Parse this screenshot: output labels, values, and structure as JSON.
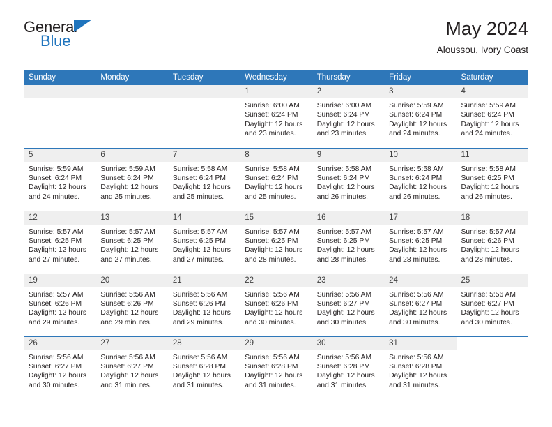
{
  "brand": {
    "name_part1": "General",
    "name_part2": "Blue",
    "triangle_icon": "triangle-icon",
    "accent_color": "#1f74bd"
  },
  "header": {
    "title": "May 2024",
    "subtitle": "Aloussou, Ivory Coast"
  },
  "theme": {
    "header_bg": "#2e77b9",
    "daynum_bg": "#efefef",
    "text": "#231f20"
  },
  "calendar": {
    "weekday_headers": [
      "Sunday",
      "Monday",
      "Tuesday",
      "Wednesday",
      "Thursday",
      "Friday",
      "Saturday"
    ],
    "weeks": [
      [
        {
          "day": "",
          "sunrise": "",
          "sunset": "",
          "daylight_line1": "",
          "daylight_line2": "",
          "blank": true
        },
        {
          "day": "",
          "sunrise": "",
          "sunset": "",
          "daylight_line1": "",
          "daylight_line2": "",
          "blank": true
        },
        {
          "day": "",
          "sunrise": "",
          "sunset": "",
          "daylight_line1": "",
          "daylight_line2": "",
          "blank": true
        },
        {
          "day": "1",
          "sunrise": "Sunrise: 6:00 AM",
          "sunset": "Sunset: 6:24 PM",
          "daylight_line1": "Daylight: 12 hours",
          "daylight_line2": "and 23 minutes."
        },
        {
          "day": "2",
          "sunrise": "Sunrise: 6:00 AM",
          "sunset": "Sunset: 6:24 PM",
          "daylight_line1": "Daylight: 12 hours",
          "daylight_line2": "and 23 minutes."
        },
        {
          "day": "3",
          "sunrise": "Sunrise: 5:59 AM",
          "sunset": "Sunset: 6:24 PM",
          "daylight_line1": "Daylight: 12 hours",
          "daylight_line2": "and 24 minutes."
        },
        {
          "day": "4",
          "sunrise": "Sunrise: 5:59 AM",
          "sunset": "Sunset: 6:24 PM",
          "daylight_line1": "Daylight: 12 hours",
          "daylight_line2": "and 24 minutes."
        }
      ],
      [
        {
          "day": "5",
          "sunrise": "Sunrise: 5:59 AM",
          "sunset": "Sunset: 6:24 PM",
          "daylight_line1": "Daylight: 12 hours",
          "daylight_line2": "and 24 minutes."
        },
        {
          "day": "6",
          "sunrise": "Sunrise: 5:59 AM",
          "sunset": "Sunset: 6:24 PM",
          "daylight_line1": "Daylight: 12 hours",
          "daylight_line2": "and 25 minutes."
        },
        {
          "day": "7",
          "sunrise": "Sunrise: 5:58 AM",
          "sunset": "Sunset: 6:24 PM",
          "daylight_line1": "Daylight: 12 hours",
          "daylight_line2": "and 25 minutes."
        },
        {
          "day": "8",
          "sunrise": "Sunrise: 5:58 AM",
          "sunset": "Sunset: 6:24 PM",
          "daylight_line1": "Daylight: 12 hours",
          "daylight_line2": "and 25 minutes."
        },
        {
          "day": "9",
          "sunrise": "Sunrise: 5:58 AM",
          "sunset": "Sunset: 6:24 PM",
          "daylight_line1": "Daylight: 12 hours",
          "daylight_line2": "and 26 minutes."
        },
        {
          "day": "10",
          "sunrise": "Sunrise: 5:58 AM",
          "sunset": "Sunset: 6:24 PM",
          "daylight_line1": "Daylight: 12 hours",
          "daylight_line2": "and 26 minutes."
        },
        {
          "day": "11",
          "sunrise": "Sunrise: 5:58 AM",
          "sunset": "Sunset: 6:25 PM",
          "daylight_line1": "Daylight: 12 hours",
          "daylight_line2": "and 26 minutes."
        }
      ],
      [
        {
          "day": "12",
          "sunrise": "Sunrise: 5:57 AM",
          "sunset": "Sunset: 6:25 PM",
          "daylight_line1": "Daylight: 12 hours",
          "daylight_line2": "and 27 minutes."
        },
        {
          "day": "13",
          "sunrise": "Sunrise: 5:57 AM",
          "sunset": "Sunset: 6:25 PM",
          "daylight_line1": "Daylight: 12 hours",
          "daylight_line2": "and 27 minutes."
        },
        {
          "day": "14",
          "sunrise": "Sunrise: 5:57 AM",
          "sunset": "Sunset: 6:25 PM",
          "daylight_line1": "Daylight: 12 hours",
          "daylight_line2": "and 27 minutes."
        },
        {
          "day": "15",
          "sunrise": "Sunrise: 5:57 AM",
          "sunset": "Sunset: 6:25 PM",
          "daylight_line1": "Daylight: 12 hours",
          "daylight_line2": "and 28 minutes."
        },
        {
          "day": "16",
          "sunrise": "Sunrise: 5:57 AM",
          "sunset": "Sunset: 6:25 PM",
          "daylight_line1": "Daylight: 12 hours",
          "daylight_line2": "and 28 minutes."
        },
        {
          "day": "17",
          "sunrise": "Sunrise: 5:57 AM",
          "sunset": "Sunset: 6:25 PM",
          "daylight_line1": "Daylight: 12 hours",
          "daylight_line2": "and 28 minutes."
        },
        {
          "day": "18",
          "sunrise": "Sunrise: 5:57 AM",
          "sunset": "Sunset: 6:26 PM",
          "daylight_line1": "Daylight: 12 hours",
          "daylight_line2": "and 28 minutes."
        }
      ],
      [
        {
          "day": "19",
          "sunrise": "Sunrise: 5:57 AM",
          "sunset": "Sunset: 6:26 PM",
          "daylight_line1": "Daylight: 12 hours",
          "daylight_line2": "and 29 minutes."
        },
        {
          "day": "20",
          "sunrise": "Sunrise: 5:56 AM",
          "sunset": "Sunset: 6:26 PM",
          "daylight_line1": "Daylight: 12 hours",
          "daylight_line2": "and 29 minutes."
        },
        {
          "day": "21",
          "sunrise": "Sunrise: 5:56 AM",
          "sunset": "Sunset: 6:26 PM",
          "daylight_line1": "Daylight: 12 hours",
          "daylight_line2": "and 29 minutes."
        },
        {
          "day": "22",
          "sunrise": "Sunrise: 5:56 AM",
          "sunset": "Sunset: 6:26 PM",
          "daylight_line1": "Daylight: 12 hours",
          "daylight_line2": "and 30 minutes."
        },
        {
          "day": "23",
          "sunrise": "Sunrise: 5:56 AM",
          "sunset": "Sunset: 6:27 PM",
          "daylight_line1": "Daylight: 12 hours",
          "daylight_line2": "and 30 minutes."
        },
        {
          "day": "24",
          "sunrise": "Sunrise: 5:56 AM",
          "sunset": "Sunset: 6:27 PM",
          "daylight_line1": "Daylight: 12 hours",
          "daylight_line2": "and 30 minutes."
        },
        {
          "day": "25",
          "sunrise": "Sunrise: 5:56 AM",
          "sunset": "Sunset: 6:27 PM",
          "daylight_line1": "Daylight: 12 hours",
          "daylight_line2": "and 30 minutes."
        }
      ],
      [
        {
          "day": "26",
          "sunrise": "Sunrise: 5:56 AM",
          "sunset": "Sunset: 6:27 PM",
          "daylight_line1": "Daylight: 12 hours",
          "daylight_line2": "and 30 minutes."
        },
        {
          "day": "27",
          "sunrise": "Sunrise: 5:56 AM",
          "sunset": "Sunset: 6:27 PM",
          "daylight_line1": "Daylight: 12 hours",
          "daylight_line2": "and 31 minutes."
        },
        {
          "day": "28",
          "sunrise": "Sunrise: 5:56 AM",
          "sunset": "Sunset: 6:28 PM",
          "daylight_line1": "Daylight: 12 hours",
          "daylight_line2": "and 31 minutes."
        },
        {
          "day": "29",
          "sunrise": "Sunrise: 5:56 AM",
          "sunset": "Sunset: 6:28 PM",
          "daylight_line1": "Daylight: 12 hours",
          "daylight_line2": "and 31 minutes."
        },
        {
          "day": "30",
          "sunrise": "Sunrise: 5:56 AM",
          "sunset": "Sunset: 6:28 PM",
          "daylight_line1": "Daylight: 12 hours",
          "daylight_line2": "and 31 minutes."
        },
        {
          "day": "31",
          "sunrise": "Sunrise: 5:56 AM",
          "sunset": "Sunset: 6:28 PM",
          "daylight_line1": "Daylight: 12 hours",
          "daylight_line2": "and 31 minutes."
        },
        {
          "day": "",
          "sunrise": "",
          "sunset": "",
          "daylight_line1": "",
          "daylight_line2": "",
          "void": true
        }
      ]
    ]
  }
}
